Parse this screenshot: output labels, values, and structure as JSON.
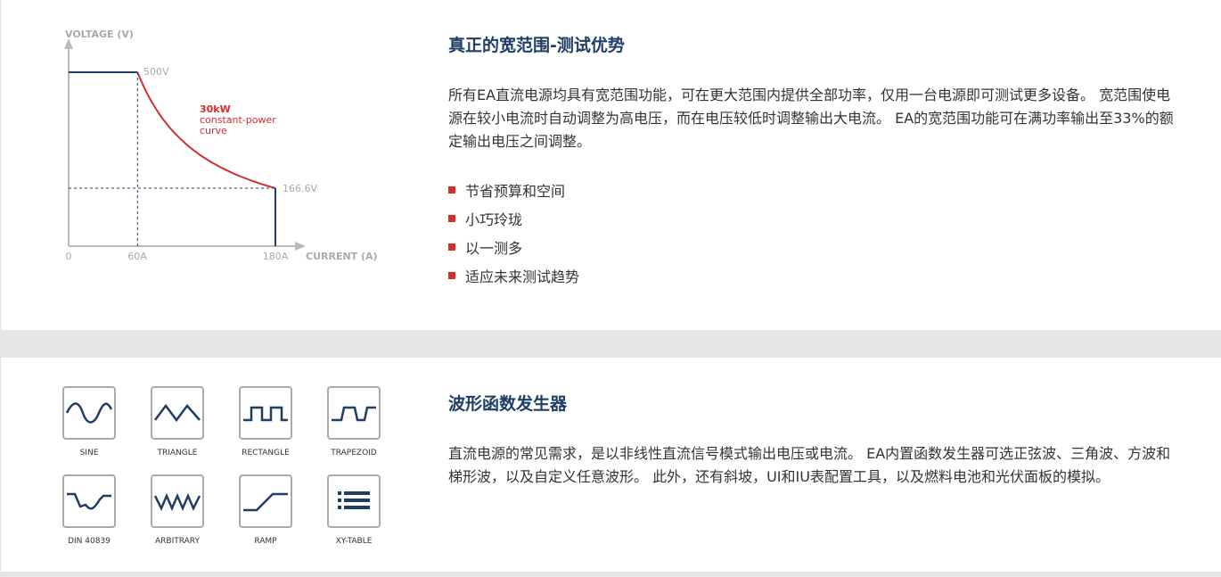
{
  "chart_data": {
    "type": "line",
    "ylabel": "VOLTAGE (V)",
    "xlabel": "CURRENT (A)",
    "x_ticks": [
      "0",
      "60A",
      "180A"
    ],
    "annotations": {
      "max_voltage": "500V",
      "min_voltage": "166.6V",
      "curve_power": "30kW",
      "curve_line2": "constant-power",
      "curve_line3": "curve"
    },
    "series": [
      {
        "name": "",
        "x": [
          0,
          60,
          80,
          100,
          120,
          140,
          160,
          180,
          180
        ],
        "y": [
          500,
          500,
          375,
          300,
          250,
          214.3,
          187.5,
          166.6,
          0
        ]
      }
    ],
    "colors": {
      "axis": "#bbbbbb",
      "line": "#1f3e66",
      "curve": "#d62d2d",
      "guide": "#1f3e66"
    }
  },
  "section1": {
    "title": "真正的宽范围-测试优势",
    "paragraph": "所有EA直流电源均具有宽范围功能，可在更大范围内提供全部功率，仅用一台电源即可测试更多设备。 宽范围使电源在较小电流时自动调整为高电压，而在电压较低时调整输出大电流。 EA的宽范围功能可在满功率输出至33%的额定输出电压之间调整。",
    "bullets": [
      "节省预算和空间",
      "小巧玲珑",
      "以一测多",
      "适应未来测试趋势"
    ]
  },
  "section2": {
    "title": "波形函数发生器",
    "paragraph": "直流电源的常见需求，是以非线性直流信号模式输出电压或电流。 EA内置函数发生器可选正弦波、三角波、方波和梯形波，以及自定义任意波形。 此外，还有斜坡，UI和IU表配置工具，以及燃料电池和光伏面板的模拟。",
    "waveforms": [
      "SINE",
      "TRIANGLE",
      "RECTANGLE",
      "TRAPEZOID",
      "DIN 40839",
      "ARBITRARY",
      "RAMP",
      "XY-TABLE"
    ]
  },
  "colors": {
    "heading": "#1f3e66",
    "bullet": "#d62d2d",
    "icon_stroke": "#1f3e66",
    "separator": "#e6e6e6"
  }
}
